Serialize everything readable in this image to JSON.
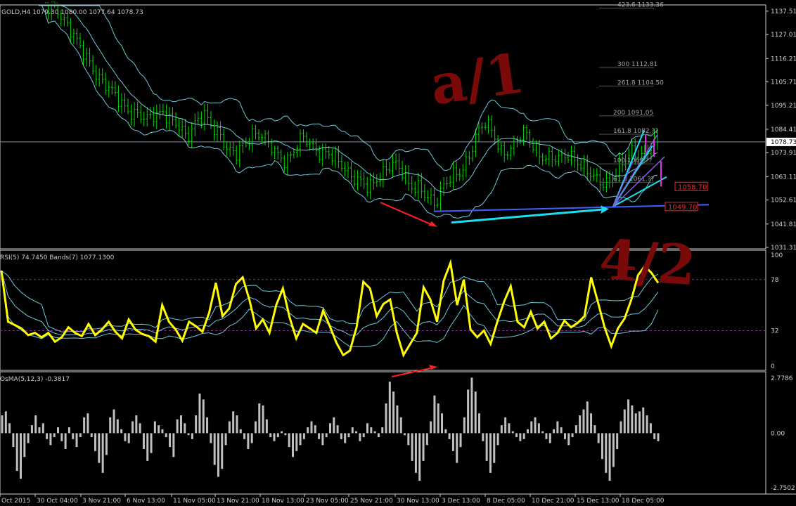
{
  "colors": {
    "background": "#000000",
    "panel_border": "#d0d0d0",
    "candles": "#00dd00",
    "bollinger": "#6fc9d8",
    "rsi": "#ffff00",
    "osma": "#c0c0c0",
    "arrow_red": "#ff2020",
    "line_cyan": "#19e0f0",
    "line_blue": "#4060ff",
    "fan": "#e030e0",
    "price_line": "#8090b0",
    "handwriting": "#7a0a0a"
  },
  "chart_data": [
    {
      "type": "candlestick",
      "panel": "main",
      "title": "GOLD,H4  1079.30 1080.00 1077.64 1078.73",
      "ylim": [
        1031.31,
        1140
      ],
      "yticks": [
        "1137.51",
        "1127.01",
        "1116.21",
        "1105.71",
        "1095.21",
        "1084.41",
        "1073.91",
        "1063.11",
        "1052.61",
        "1041.81",
        "1031.31"
      ],
      "current_price": "1078.73",
      "close_path": [
        1145,
        1138,
        1140,
        1135,
        1128,
        1120,
        1116,
        1110,
        1104,
        1100,
        1097,
        1093,
        1090,
        1088,
        1092,
        1093,
        1087,
        1085,
        1082,
        1088,
        1090,
        1085,
        1083,
        1075,
        1072,
        1078,
        1084,
        1082,
        1076,
        1073,
        1071,
        1075,
        1080,
        1078,
        1075,
        1073,
        1070,
        1068,
        1064,
        1060,
        1057,
        1063,
        1067,
        1068,
        1065,
        1060,
        1059,
        1053,
        1050,
        1060,
        1064,
        1063,
        1070,
        1083,
        1088,
        1082,
        1074,
        1076,
        1080,
        1082,
        1077,
        1073,
        1071,
        1070,
        1074,
        1072,
        1066,
        1063,
        1062,
        1061,
        1064,
        1070,
        1076,
        1072,
        1074,
        1079
      ],
      "bands": {
        "period_label": "Bollinger"
      },
      "fib_levels": [
        {
          "label": "423.6 1133.36",
          "value": 1139.5
        },
        {
          "label": "300 1112.81",
          "value": 1112.81
        },
        {
          "label": "261.8 1104.50",
          "value": 1104.5
        },
        {
          "label": "200 1091.05",
          "value": 1091.05
        },
        {
          "label": "161.8 1082.??",
          "value": 1082.8
        },
        {
          "label": "100 1069.??",
          "value": 1069.5
        },
        {
          "label": "61.8 1061.??",
          "value": 1061.2
        }
      ],
      "price_tags": [
        {
          "label": "1058.70",
          "value": 1058.7,
          "color": "#ff2020"
        },
        {
          "label": "1049.70",
          "value": 1049.7,
          "color": "#ff2020"
        }
      ]
    },
    {
      "type": "line",
      "panel": "rsi",
      "title": "RSI(5) 74.7450  Bands(7) 1077.1300",
      "ylim": [
        0,
        100
      ],
      "yticks": [
        "100",
        "78",
        "32",
        "0"
      ],
      "levels": [
        78,
        32
      ],
      "series": [
        {
          "values": [
            86,
            40,
            37,
            34,
            28,
            30,
            26,
            30,
            22,
            26,
            35,
            30,
            27,
            38,
            28,
            33,
            40,
            31,
            25,
            42,
            33,
            29,
            27,
            22,
            55,
            40,
            33,
            23,
            40,
            36,
            31,
            48,
            75,
            45,
            52,
            74,
            80,
            60,
            34,
            42,
            30,
            55,
            70,
            44,
            25,
            38,
            34,
            30,
            50,
            36,
            21,
            10,
            14,
            35,
            76,
            70,
            45,
            56,
            60,
            30,
            10,
            20,
            30,
            71,
            60,
            40,
            77,
            93,
            55,
            78,
            33,
            26,
            32,
            20,
            40,
            58,
            72,
            40,
            35,
            49,
            34,
            40,
            25,
            30,
            41,
            35,
            39,
            45,
            80,
            58,
            35,
            18,
            34,
            43,
            60,
            82,
            90,
            84,
            75
          ]
        }
      ]
    },
    {
      "type": "bar",
      "panel": "osma",
      "title": "OsMA(5,12,3) -0.3817",
      "ylim": [
        -2.75,
        2.7786
      ],
      "yticks": [
        "2.7786",
        "0.00",
        "-2.7502"
      ],
      "values": [
        0.9,
        1.1,
        0.5,
        -0.7,
        -1.9,
        -2.3,
        -1.2,
        -0.5,
        0.4,
        0.9,
        0.3,
        0.5,
        -0.3,
        -0.6,
        -0.2,
        0.3,
        -0.4,
        -0.8,
        0.3,
        -0.3,
        -0.7,
        -0.2,
        0.8,
        1.0,
        -0.2,
        -0.9,
        -1.5,
        -2.0,
        -1.1,
        0.8,
        1.2,
        0.7,
        0.2,
        -0.4,
        -0.5,
        0.6,
        0.9,
        0.5,
        -0.8,
        -1.4,
        -1.0,
        0.6,
        0.4,
        0.2,
        -0.2,
        -0.7,
        -1.2,
        0.7,
        0.9,
        0.5,
        -0.1,
        -0.3,
        0.9,
        2.0,
        1.7,
        0.8,
        -0.5,
        -1.6,
        -2.2,
        -1.8,
        -0.6,
        0.6,
        1.1,
        0.9,
        0.2,
        -0.3,
        -0.8,
        -0.5,
        0.6,
        1.5,
        1.4,
        0.7,
        -0.2,
        -0.4,
        -0.2,
        0.1,
        -0.1,
        -0.7,
        -1.2,
        -0.9,
        -0.6,
        -0.3,
        0.3,
        0.6,
        0.4,
        -0.3,
        -0.6,
        -0.2,
        0.5,
        0.8,
        0.4,
        -0.3,
        -0.5,
        -0.2,
        0.3,
        0.1,
        -0.4,
        -0.2,
        0.5,
        0.3,
        0.1,
        -0.2,
        0.3,
        1.5,
        2.6,
        2.1,
        1.4,
        0.8,
        -0.1,
        -0.6,
        -1.4,
        -2.0,
        -2.4,
        -1.4,
        -0.6,
        0.6,
        1.9,
        1.5,
        1.0,
        0.2,
        -0.3,
        -0.9,
        -1.5,
        -0.7,
        0.8,
        2.2,
        2.8,
        2.1,
        1.0,
        -0.4,
        -1.4,
        -2.0,
        -1.5,
        -0.6,
        0.4,
        0.8,
        0.5,
        0.1,
        -0.2,
        -0.4,
        -0.3,
        0.2,
        0.6,
        0.8,
        0.5,
        0.1,
        -0.3,
        -0.5,
        0.2,
        0.6,
        0.3,
        -0.3,
        -0.6,
        -0.2,
        0.4,
        0.9,
        1.2,
        1.6,
        1.0,
        0.4,
        -0.5,
        -1.3,
        -2.0,
        -2.4,
        -1.7,
        -0.8,
        0.6,
        1.2,
        1.7,
        1.4,
        1.0,
        1.1,
        1.3,
        0.9,
        0.5,
        -0.3,
        -0.4
      ]
    }
  ],
  "x_axis": {
    "labels": [
      "Oct 2015",
      "30 Oct 04:00",
      "3 Nov 21:00",
      "6 Nov 13:00",
      "11 Nov 05:00",
      "13 Nov 21:00",
      "18 Nov 13:00",
      "23 Nov 05:00",
      "25 Nov 21:00",
      "30 Nov 13:00",
      "3 Dec 13:00",
      "8 Dec 05:00",
      "10 Dec 21:00",
      "15 Dec 13:00",
      "18 Dec 05:00"
    ]
  },
  "annotations": {
    "hand_top": "a/1",
    "hand_bottom": "4/2"
  }
}
